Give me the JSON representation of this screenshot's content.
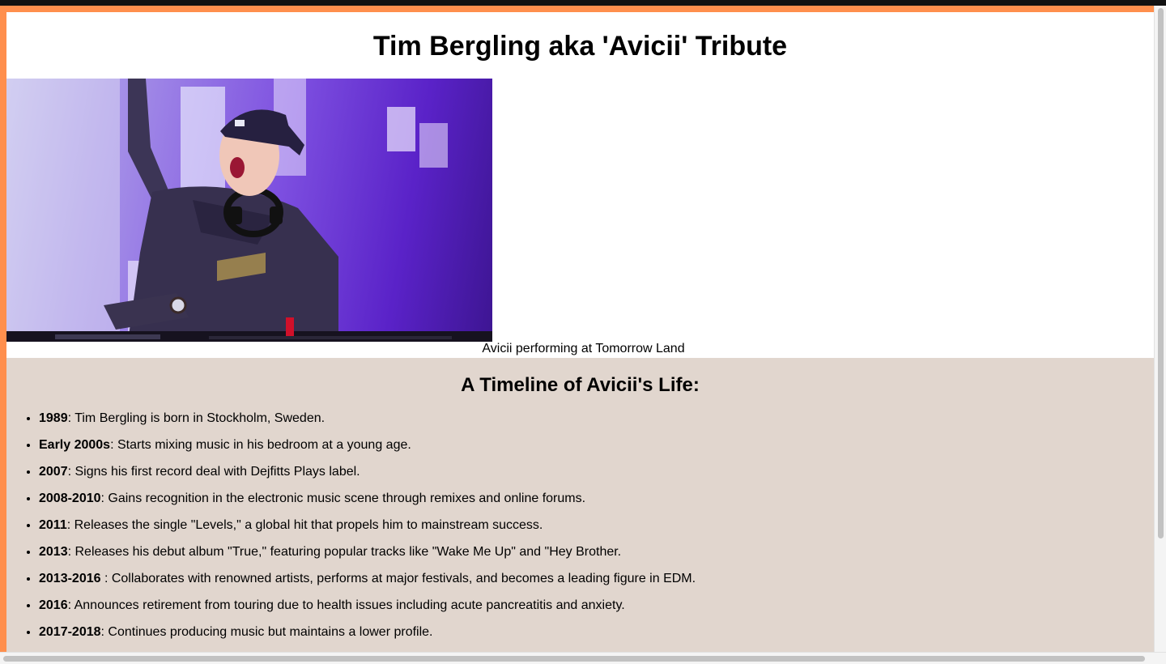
{
  "page": {
    "title": "Tim Bergling aka 'Avicii' Tribute",
    "image": {
      "semantic": "avicii-performing-photo"
    },
    "caption": "Avicii performing at Tomorrow Land"
  },
  "timeline": {
    "heading": "A Timeline of Avicii's Life:",
    "items": [
      {
        "year": "1989",
        "text": ": Tim Bergling is born in Stockholm, Sweden."
      },
      {
        "year": "Early 2000s",
        "text": ": Starts mixing music in his bedroom at a young age."
      },
      {
        "year": "2007",
        "text": ": Signs his first record deal with Dejfitts Plays label."
      },
      {
        "year": "2008-2010",
        "text": ": Gains recognition in the electronic music scene through remixes and online forums."
      },
      {
        "year": "2011",
        "text": ": Releases the single \"Levels,\" a global hit that propels him to mainstream success."
      },
      {
        "year": "2013",
        "text": ": Releases his debut album \"True,\" featuring popular tracks like \"Wake Me Up\" and \"Hey Brother."
      },
      {
        "year": "2013-2016",
        "text": " : Collaborates with renowned artists, performs at major festivals, and becomes a leading figure in EDM."
      },
      {
        "year": "2016",
        "text": ": Announces retirement from touring due to health issues including acute pancreatitis and anxiety."
      },
      {
        "year": "2017-2018",
        "text": ": Continues producing music but maintains a lower profile."
      }
    ]
  },
  "colors": {
    "accent_border": "#ff8f4d",
    "timeline_background": "#e1d6ce"
  }
}
